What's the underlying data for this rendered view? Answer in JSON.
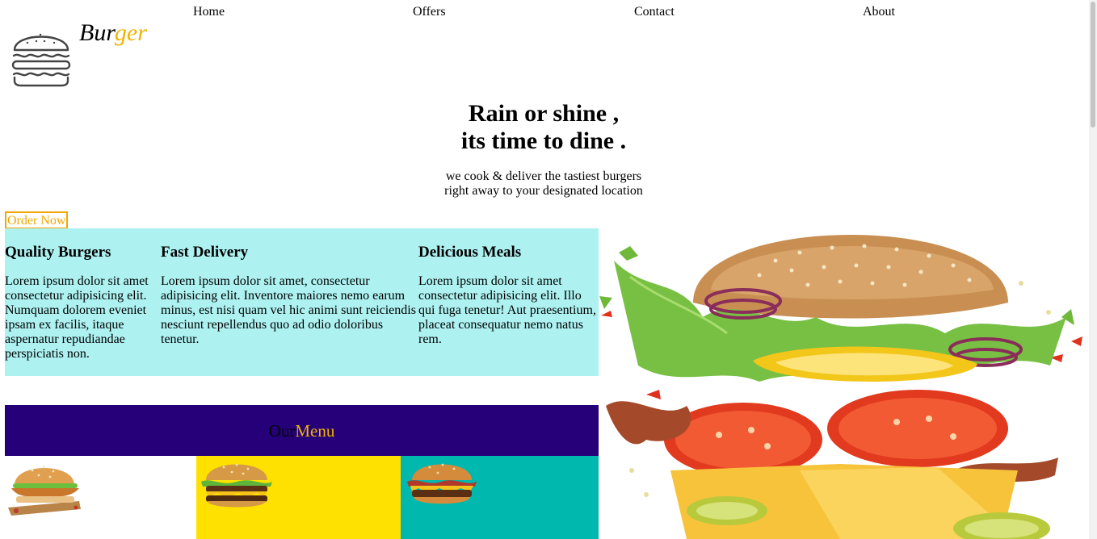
{
  "nav": {
    "items": [
      "Home",
      "Offers",
      "Contact",
      "About"
    ]
  },
  "logo": {
    "icon": "burger-outline-icon",
    "text_part1": "Bur",
    "text_part2": "ger",
    "accent_color": "#f0b400"
  },
  "hero": {
    "title_line1": "Rain or shine ,",
    "title_line2": "its time to dine .",
    "sub_line1": "we cook & deliver the tastiest burgers",
    "sub_line2": "right away to your designated location",
    "order_button": "Order Now"
  },
  "features": [
    {
      "title": "Quality Burgers",
      "text": "Lorem ipsum dolor sit amet consectetur adipisicing elit. Numquam dolorem eveniet ipsam ex facilis, itaque aspernatur repudiandae perspiciatis non."
    },
    {
      "title": "Fast Delivery",
      "text": "Lorem ipsum dolor sit amet, consectetur adipisicing elit. Inventore maiores nemo earum minus, est nisi quam vel hic animi sunt reiciendis nesciunt repellendus quo ad odio doloribus tenetur."
    },
    {
      "title": "Delicious Meals",
      "text": "Lorem ipsum dolor sit amet consectetur adipisicing elit. Illo qui fuga tenetur! Aut praesentium, placeat consequatur nemo natus rem."
    }
  ],
  "menu": {
    "title_part1": "Our",
    "title_part2": "Menu",
    "bar_color": "#260078",
    "cells": [
      {
        "bg": "#ffffff",
        "image": "crispy-chicken-burger"
      },
      {
        "bg": "#ffe100",
        "image": "double-cheeseburger"
      },
      {
        "bg": "#00b8ad",
        "image": "bacon-cheeseburger"
      }
    ]
  },
  "colors": {
    "features_bg": "#adf1f1",
    "accent": "#f0b400",
    "menu_bar": "#260078"
  }
}
